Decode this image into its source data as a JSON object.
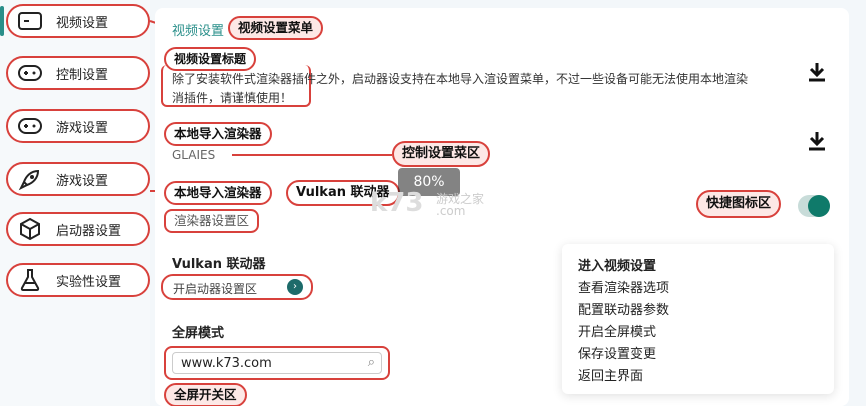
{
  "sidebar": {
    "items": [
      {
        "label": "视频设置",
        "icon": "screen-icon"
      },
      {
        "label": "控制设置",
        "icon": "gamepad-icon"
      },
      {
        "label": "游戏设置",
        "icon": "gamepad-icon"
      },
      {
        "label": "游戏设置",
        "icon": "rocket-icon"
      },
      {
        "label": "启动器设置",
        "icon": "box-icon"
      },
      {
        "label": "实验性设置",
        "icon": "flask-icon"
      }
    ]
  },
  "main": {
    "video_settings_link": "视频设置",
    "video_menu_tag": "视频设置菜单",
    "video_title_tag": "视频设置标题",
    "description_line1": "除了安装软件式渲染器插件之外，启动器设支持在本地导入渲设置菜单，不过一些设备可能无法使用本地渲染",
    "description_line2": "消插件，请谨慎使用！",
    "local_import_tag1": "本地导入渲染器",
    "renderer_value": "GLAIES",
    "control_area_tag": "控制设置菜区",
    "local_import_tag2": "本地导入渲染器",
    "vulkan_tag": "Vulkan 联动器",
    "renderer_settings_tag": "渲染器设置区",
    "vulkan_heading": "Vulkan 联动器",
    "launcher_settings_text": "开启动器设置区",
    "fullscreen_heading": "全屏模式",
    "url_input_value": "www.k73.com",
    "fullscreen_toggle_tag": "全屏开关区",
    "shortcut_tag": "快捷图标区"
  },
  "menu": {
    "items": [
      "进入视频设置",
      "查看渲染器选项",
      "配置联动器参数",
      "开启全屏模式",
      "保存设置变更",
      "返回主界面"
    ]
  },
  "toggle": {
    "on": true
  },
  "watermark": {
    "percent": "80%",
    "brand": "k73",
    "site": "游戏之家",
    "domain": ".com"
  },
  "colors": {
    "accent": "#2a8f8a",
    "annotation": "#d8413c",
    "toggle_on": "#0f7a6a"
  }
}
